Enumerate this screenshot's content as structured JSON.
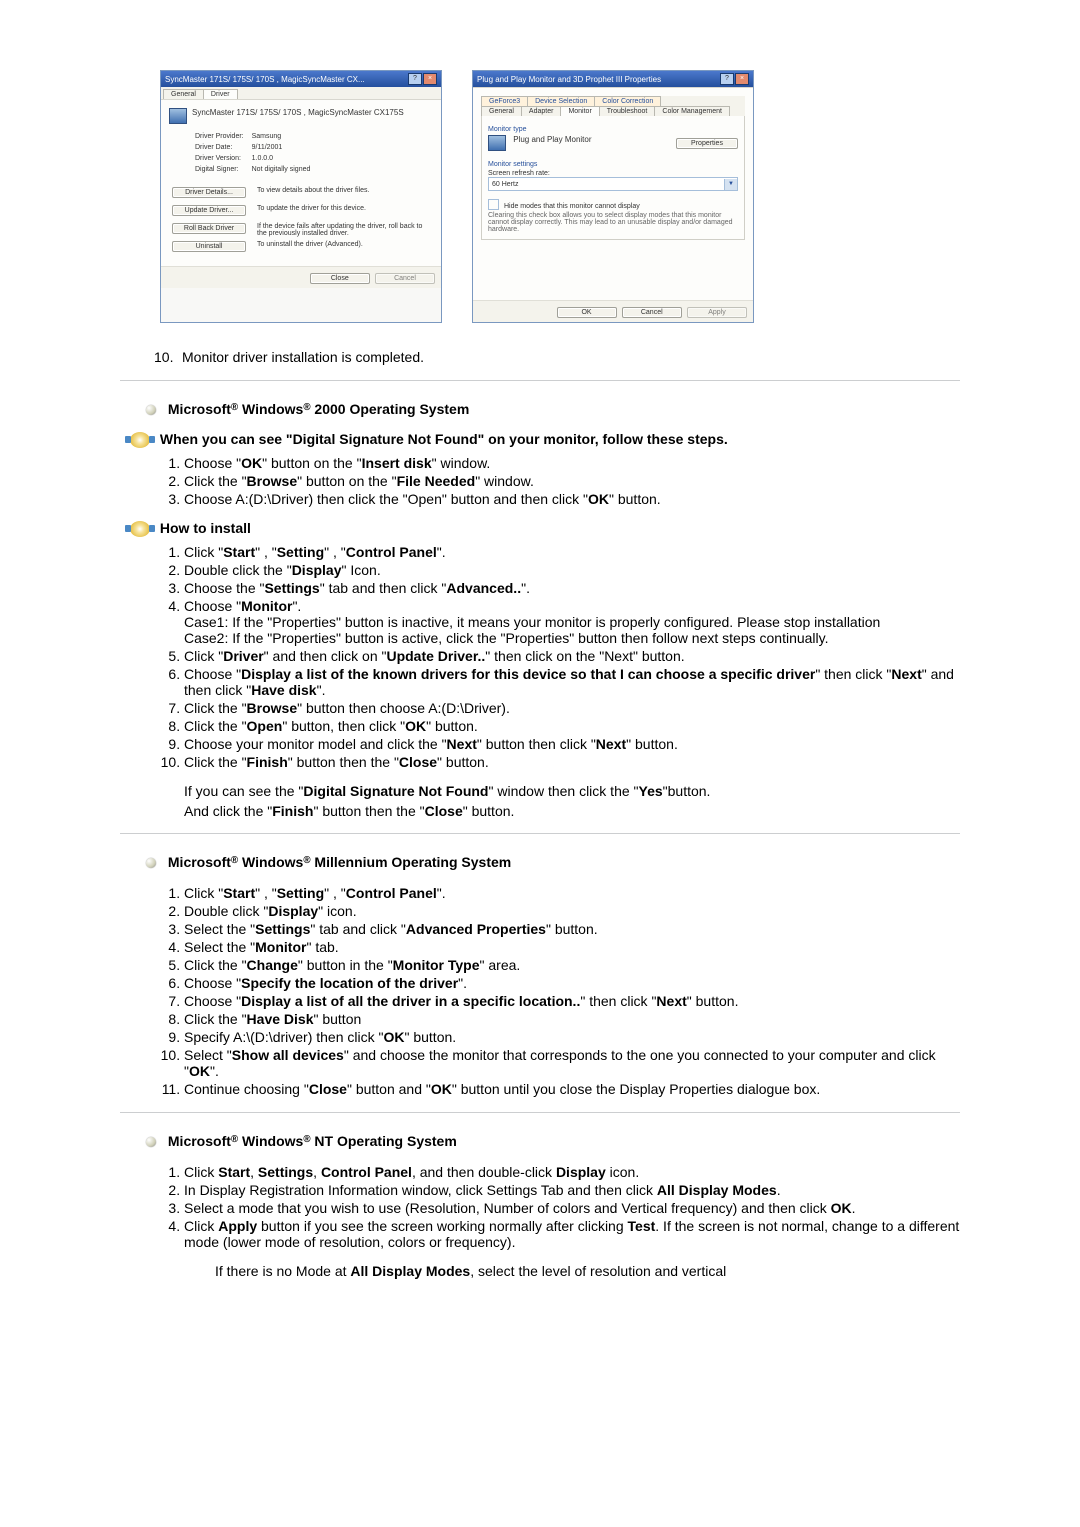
{
  "dialog1": {
    "title": "SyncMaster 171S/ 175S/ 170S , MagicSyncMaster CX...",
    "tabs": {
      "general": "General",
      "driver": "Driver"
    },
    "name": "SyncMaster 171S/ 175S/ 170S , MagicSyncMaster CX175S",
    "rows": {
      "provider_l": "Driver Provider:",
      "provider_v": "Samsung",
      "date_l": "Driver Date:",
      "date_v": "9/11/2001",
      "version_l": "Driver Version:",
      "version_v": "1.0.0.0",
      "signer_l": "Digital Signer:",
      "signer_v": "Not digitally signed"
    },
    "btns": {
      "details": "Driver Details...",
      "details_d": "To view details about the driver files.",
      "update": "Update Driver...",
      "update_d": "To update the driver for this device.",
      "rollback": "Roll Back Driver",
      "rollback_d": "If the device fails after updating the driver, roll back to the previously installed driver.",
      "uninstall": "Uninstall",
      "uninstall_d": "To uninstall the driver (Advanced).",
      "close": "Close",
      "cancel": "Cancel"
    }
  },
  "dialog2": {
    "title": "Plug and Play Monitor and 3D Prophet III Properties",
    "tabs": {
      "geforce": "GeForce3",
      "devsel": "Device Selection",
      "colorc": "Color Correction",
      "general": "General",
      "adapter": "Adapter",
      "monitor": "Monitor",
      "trouble": "Troubleshoot",
      "cmgmt": "Color Management"
    },
    "montype_l": "Monitor type",
    "montype_v": "Plug and Play Monitor",
    "props_btn": "Properties",
    "mset_l": "Monitor settings",
    "refresh_l": "Screen refresh rate:",
    "refresh_v": "60 Hertz",
    "chk_l": "Hide modes that this monitor cannot display",
    "chk_d": "Clearing this check box allows you to select display modes that this monitor cannot display correctly. This may lead to an unusable display and/or damaged hardware.",
    "ok": "OK",
    "cancel": "Cancel",
    "apply": "Apply"
  },
  "note10": "Monitor driver installation is completed.",
  "sec2000": {
    "title_a": "Microsoft",
    "title_b": " Windows",
    "title_c": " 2000 Operating System",
    "sub1": "When you can see \"Digital Signature Not Found\" on your monitor, follow these steps.",
    "l1a": "Choose \"",
    "l1b": "OK",
    "l1c": "\" button on the \"",
    "l1d": "Insert disk",
    "l1e": "\" window.",
    "l2a": "Click the \"",
    "l2b": "Browse",
    "l2c": "\" button on the \"",
    "l2d": "File Needed",
    "l2e": "\" window.",
    "l3a": "Choose A:(D:\\Driver) then click the \"Open\" button and then click \"",
    "l3b": "OK",
    "l3c": "\" button.",
    "sub2": "How to install",
    "h1a": "Click \"",
    "h1b": "Start",
    "h1c": "\" , \"",
    "h1d": "Setting",
    "h1e": "\" , \"",
    "h1f": "Control Panel",
    "h1g": "\".",
    "h2a": "Double click the \"",
    "h2b": "Display",
    "h2c": "\" Icon.",
    "h3a": "Choose the \"",
    "h3b": "Settings",
    "h3c": "\" tab and then click \"",
    "h3d": "Advanced..",
    "h3e": "\".",
    "h4a": "Choose \"",
    "h4b": "Monitor",
    "h4c": "\".",
    "case1": "Case1: If the \"Properties\" button is inactive, it means your monitor is properly configured. Please stop installation",
    "case2": "Case2: If the \"Properties\" button is active, click the \"Properties\" button then follow next steps continually.",
    "h5a": "Click \"",
    "h5b": "Driver",
    "h5c": "\" and then click on \"",
    "h5d": "Update Driver..",
    "h5e": "\" then click on the \"Next\" button.",
    "h6a": "Choose \"",
    "h6b": "Display a list of the known drivers for this device so that I can choose a specific driver",
    "h6c": "\" then click \"",
    "h6d": "Next",
    "h6e": "\" and then click \"",
    "h6f": "Have disk",
    "h6g": "\".",
    "h7a": "Click the \"",
    "h7b": "Browse",
    "h7c": "\" button then choose A:(D:\\Driver).",
    "h8a": "Click the \"",
    "h8b": "Open",
    "h8c": "\" button, then click \"",
    "h8d": "OK",
    "h8e": "\" button.",
    "h9a": "Choose your monitor model and click the \"",
    "h9b": "Next",
    "h9c": "\" button then click \"",
    "h9d": "Next",
    "h9e": "\" button.",
    "h10a": "Click the \"",
    "h10b": "Finish",
    "h10c": "\" button then the \"",
    "h10d": "Close",
    "h10e": "\" button.",
    "post1a": "If you can see the \"",
    "post1b": "Digital Signature Not Found",
    "post1c": "\" window then click the \"",
    "post1d": "Yes",
    "post1e": "\"button.",
    "post2a": "And click the \"",
    "post2b": "Finish",
    "post2c": "\" button then the \"",
    "post2d": "Close",
    "post2e": "\" button."
  },
  "secME": {
    "title_c": " Millennium Operating System",
    "m1a": "Click \"",
    "m1b": "Start",
    "m1c": "\" , \"",
    "m1d": "Setting",
    "m1e": "\" , \"",
    "m1f": "Control Panel",
    "m1g": "\".",
    "m2a": "Double click \"",
    "m2b": "Display",
    "m2c": "\" icon.",
    "m3a": "Select the \"",
    "m3b": "Settings",
    "m3c": "\" tab and click \"",
    "m3d": "Advanced Properties",
    "m3e": "\" button.",
    "m4a": "Select the \"",
    "m4b": "Monitor",
    "m4c": "\" tab.",
    "m5a": "Click the \"",
    "m5b": "Change",
    "m5c": "\" button in the \"",
    "m5d": "Monitor Type",
    "m5e": "\" area.",
    "m6a": "Choose \"",
    "m6b": "Specify the location of the driver",
    "m6c": "\".",
    "m7a": "Choose \"",
    "m7b": "Display a list of all the driver in a specific location..",
    "m7c": "\" then click \"",
    "m7d": "Next",
    "m7e": "\" button.",
    "m8a": "Click the \"",
    "m8b": "Have Disk",
    "m8c": "\" button",
    "m9a": "Specify A:\\(D:\\driver) then click \"",
    "m9b": "OK",
    "m9c": "\" button.",
    "m10a": "Select \"",
    "m10b": "Show all devices",
    "m10c": "\" and choose the monitor that corresponds to the one you connected to your computer and click \"",
    "m10d": "OK",
    "m10e": "\".",
    "m11a": "Continue choosing \"",
    "m11b": "Close",
    "m11c": "\" button and \"",
    "m11d": "OK",
    "m11e": "\" button until you close the Display Properties dialogue box."
  },
  "secNT": {
    "title_c": " NT Operating System",
    "n1a": "Click ",
    "n1b": "Start",
    "n1c": ", ",
    "n1d": "Settings",
    "n1e": ", ",
    "n1f": "Control Panel",
    "n1g": ", and then double-click ",
    "n1h": "Display",
    "n1i": " icon.",
    "n2a": "In Display Registration Information window, click Settings Tab and then click ",
    "n2b": "All Display Modes",
    "n2c": ".",
    "n3a": "Select a mode that you wish to use (Resolution, Number of colors and Vertical frequency) and then click ",
    "n3b": "OK",
    "n3c": ".",
    "n4a": "Click ",
    "n4b": "Apply",
    "n4c": " button if you see the screen working normally after clicking ",
    "n4d": "Test",
    "n4e": ". If the screen is not normal, change to a different mode (lower mode of resolution, colors or frequency).",
    "trail_a": "If there is no Mode at ",
    "trail_b": "All Display Modes",
    "trail_c": ", select the level of resolution and vertical"
  }
}
